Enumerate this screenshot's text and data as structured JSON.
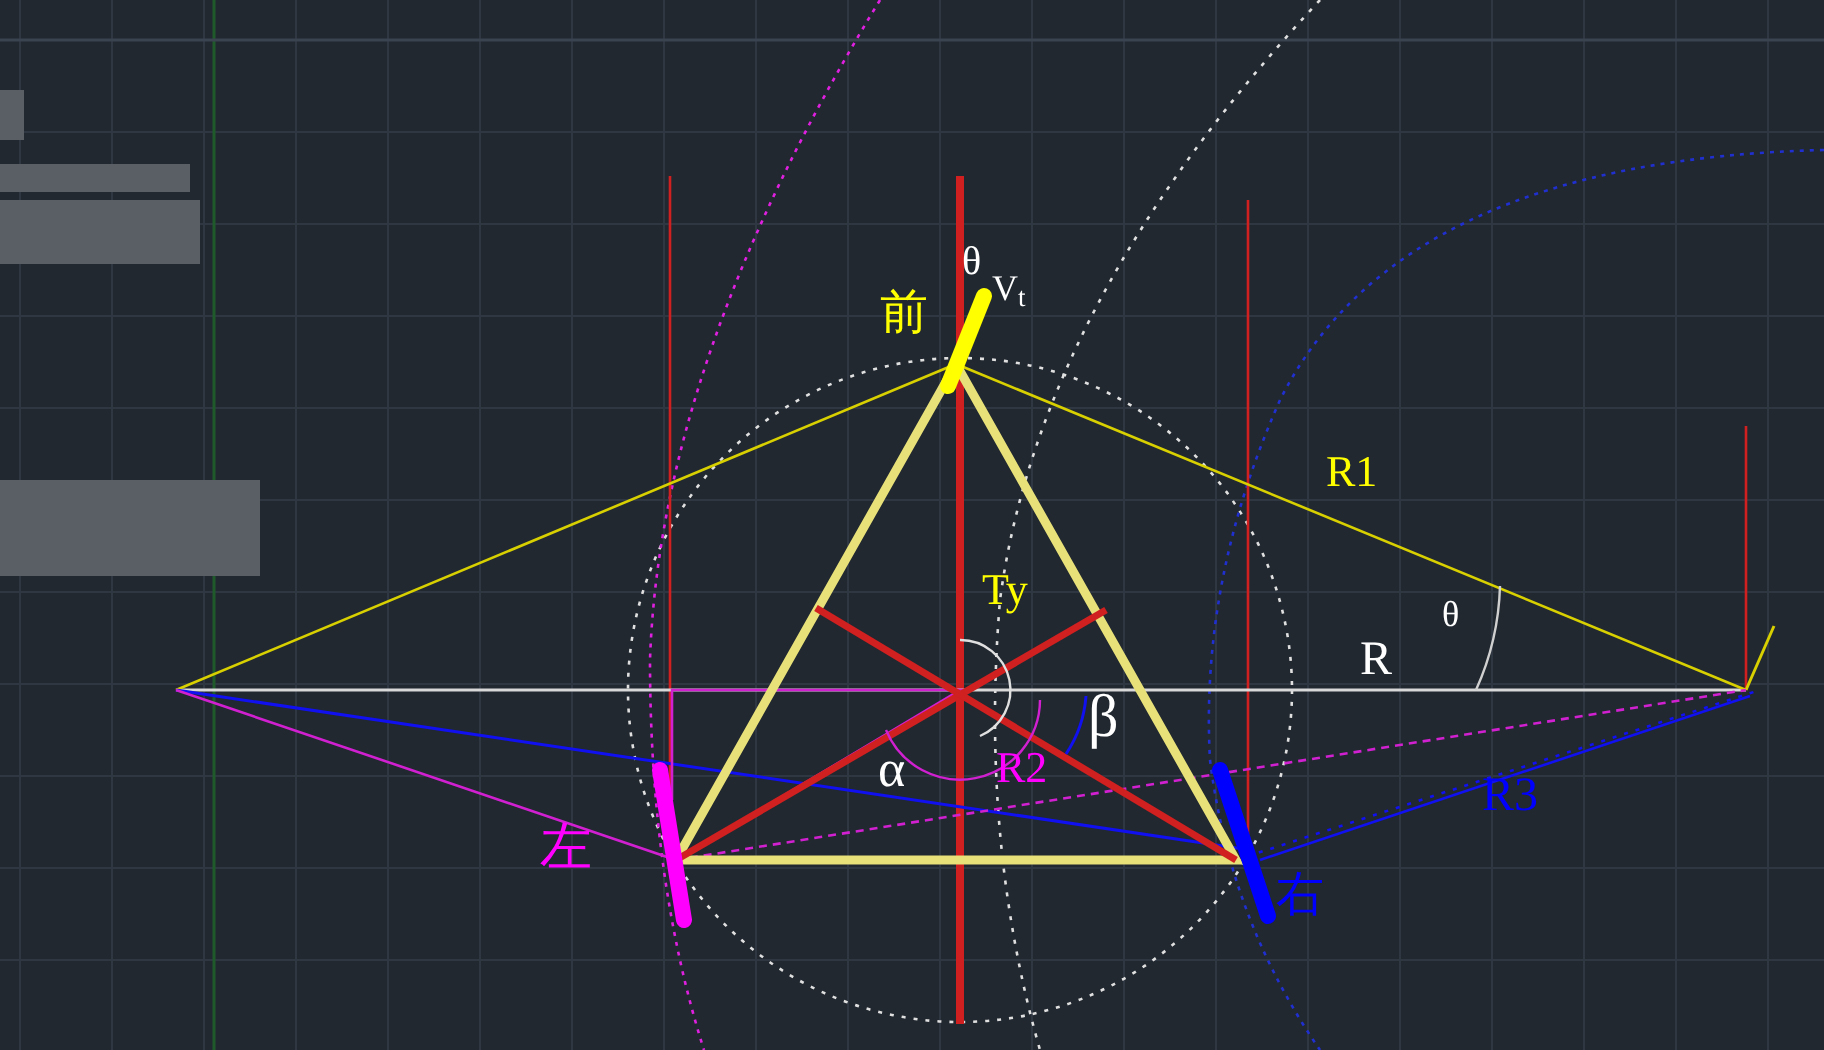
{
  "labels": [
    {
      "text": "前",
      "color": "#ffff00"
    },
    {
      "text": "θ",
      "color": "#ffffff"
    },
    {
      "text": "V$_{t}$",
      "color": "#ffffff"
    },
    {
      "text": "Ty",
      "color": "#ffff00"
    },
    {
      "text": "R1",
      "color": "#ffff00"
    },
    {
      "text": "θ",
      "color": "#ffffff"
    },
    {
      "text": "R",
      "color": "#ffffff"
    },
    {
      "text": "β",
      "color": "#ffffff"
    },
    {
      "text": "R2",
      "color": "#ff00ff"
    },
    {
      "text": "α",
      "color": "#ffffff"
    },
    {
      "text": "左",
      "color": "#ff00ff"
    },
    {
      "text": "右",
      "color": "#0000ff"
    },
    {
      "text": "R3",
      "color": "#0000ff"
    }
  ]
}
